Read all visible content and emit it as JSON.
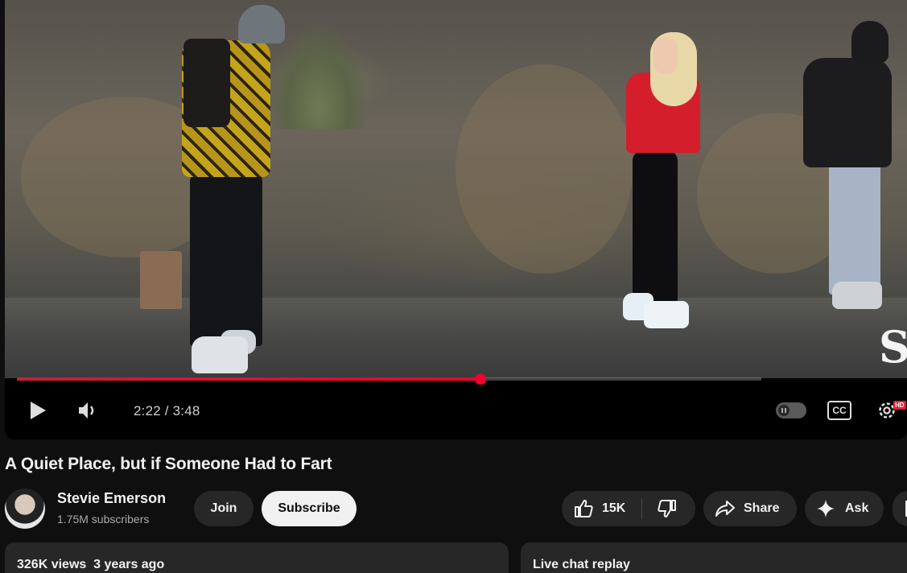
{
  "player": {
    "watermark_text": "S",
    "progress_fraction": 0.623,
    "current_time": "2:22",
    "duration": "3:48",
    "time_display": "2:22 / 3:48",
    "cc_label": "CC",
    "hd_badge": "HD",
    "accent_color": "#f0002f",
    "icons": [
      "play-icon",
      "volume-icon",
      "autoplay-toggle",
      "captions-icon",
      "settings-gear-icon"
    ]
  },
  "video": {
    "title": "A Quiet Place, but if Someone Had to Fart"
  },
  "channel": {
    "name": "Stevie Emerson",
    "subscribers": "1.75M subscribers",
    "join_label": "Join",
    "subscribe_label": "Subscribe"
  },
  "actions": {
    "like_count": "15K",
    "share_label": "Share",
    "ask_label": "Ask",
    "icons": [
      "thumbs-up-icon",
      "thumbs-down-icon",
      "share-arrow-icon",
      "sparkle-icon"
    ]
  },
  "description": {
    "views": "326K views",
    "age": "3 years ago",
    "meta": "326K views  3 years ago"
  },
  "chat": {
    "label": "Live chat replay"
  }
}
